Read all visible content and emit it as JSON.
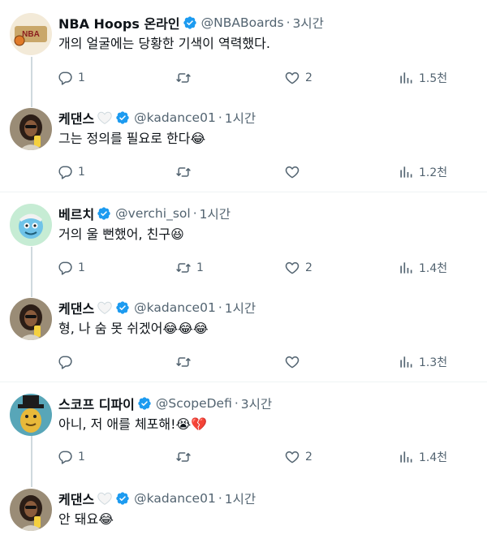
{
  "tweets": [
    {
      "name": "NBA Hoops 온라인",
      "handle": "@NBABoards",
      "time": "3시간",
      "text": "개의 얼굴에는 당황한 기색이 역력했다.",
      "emoji": "",
      "replies": "1",
      "retweets": "",
      "likes": "2",
      "views": "1.5천",
      "avatar_icon": "nba-logo-avatar",
      "badge": "verified-icon"
    },
    {
      "name": "케댄스",
      "handle": "@kadance01",
      "time": "1시간",
      "text": "그는 정의를 필요로 한다",
      "emoji": "😂",
      "replies": "1",
      "retweets": "",
      "likes": "",
      "views": "1.2천",
      "avatar_icon": "selfie-avatar",
      "badge": "white-heart-icon"
    },
    {
      "name": "베르치",
      "handle": "@verchi_sol",
      "time": "1시간",
      "text": "거의 울 뻔했어, 친구",
      "emoji": "😆",
      "replies": "1",
      "retweets": "1",
      "likes": "2",
      "views": "1.4천",
      "avatar_icon": "blue-cartoon-avatar",
      "badge": "verified-icon"
    },
    {
      "name": "케댄스",
      "handle": "@kadance01",
      "time": "1시간",
      "text": "형, 나 숨 못 쉬겠어",
      "emoji": "😂😂😂",
      "replies": "",
      "retweets": "",
      "likes": "",
      "views": "1.3천",
      "avatar_icon": "selfie-avatar",
      "badge": "white-heart-icon"
    },
    {
      "name": "스코프 디파이",
      "handle": "@ScopeDefi",
      "time": "3시간",
      "text": "아니, 저 애를 체포해!",
      "emoji": "😭💔",
      "replies": "1",
      "retweets": "",
      "likes": "2",
      "views": "1.4천",
      "avatar_icon": "hat-character-avatar",
      "badge": "verified-icon"
    },
    {
      "name": "케댄스",
      "handle": "@kadance01",
      "time": "1시간",
      "text": "안 돼요",
      "emoji": "😂",
      "replies": "",
      "retweets": "",
      "likes": "",
      "views": "",
      "avatar_icon": "selfie-avatar",
      "badge": "white-heart-icon"
    }
  ],
  "colors": {
    "text": "#0f1419",
    "secondary": "#536471",
    "verified": "#1d9bf0",
    "divider": "#eff3f4",
    "thread_line": "#cfd9de"
  },
  "icons": {
    "reply": "reply-icon",
    "retweet": "retweet-icon",
    "like": "heart-icon",
    "views": "views-icon"
  }
}
